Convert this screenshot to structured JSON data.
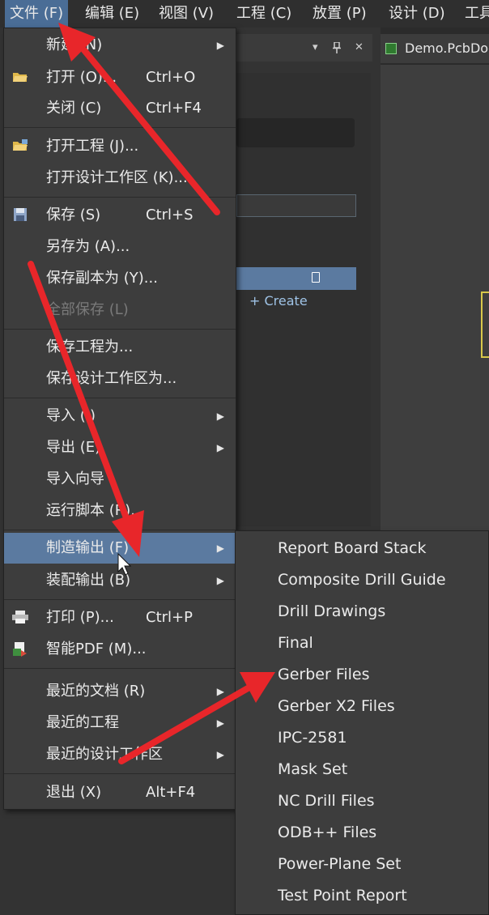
{
  "menubar": {
    "items": [
      {
        "label": "文件 (F)",
        "active": true
      },
      {
        "label": "编辑 (E)"
      },
      {
        "label": "视图 (V)"
      },
      {
        "label": "工程 (C)"
      },
      {
        "label": "放置 (P)"
      },
      {
        "label": "设计 (D)"
      },
      {
        "label": "工具"
      }
    ]
  },
  "panel": {
    "dropdown_icon": "▾",
    "pin_icon": "pin",
    "close_icon": "✕",
    "create_label": "+ Create"
  },
  "document_tab": {
    "label": "Demo.PcbDoc",
    "icon": "pcb-doc-icon"
  },
  "file_menu": {
    "items": [
      {
        "label": "新建 (N)",
        "submenu": true
      },
      {
        "label": "打开 (O)...",
        "shortcut": "Ctrl+O",
        "icon": "open-folder-icon"
      },
      {
        "label": "关闭 (C)",
        "shortcut": "Ctrl+F4"
      },
      {
        "label": "打开工程 (J)...",
        "icon": "open-project-icon"
      },
      {
        "label": "打开设计工作区 (K)..."
      },
      {
        "label": "保存 (S)",
        "shortcut": "Ctrl+S",
        "icon": "save-icon"
      },
      {
        "label": "另存为 (A)..."
      },
      {
        "label": "保存副本为 (Y)..."
      },
      {
        "label": "全部保存 (L)",
        "disabled": true
      },
      {
        "label": "保存工程为..."
      },
      {
        "label": "保存设计工作区为..."
      },
      {
        "label": "导入 (I)",
        "submenu": true
      },
      {
        "label": "导出 (E)",
        "submenu": true
      },
      {
        "label": "导入向导"
      },
      {
        "label": "运行脚本 (R)..."
      },
      {
        "label": "制造输出 (F)",
        "submenu": true,
        "highlighted": true
      },
      {
        "label": "装配输出 (B)",
        "submenu": true
      },
      {
        "label": "打印 (P)...",
        "shortcut": "Ctrl+P",
        "icon": "printer-icon"
      },
      {
        "label": "智能PDF (M)...",
        "icon": "pdf-icon"
      },
      {
        "label": "最近的文档 (R)",
        "submenu": true
      },
      {
        "label": "最近的工程",
        "submenu": true
      },
      {
        "label": "最近的设计工作区",
        "submenu": true
      },
      {
        "label": "退出 (X)",
        "shortcut": "Alt+F4"
      }
    ]
  },
  "fab_submenu": {
    "items": [
      {
        "label": "Report Board Stack"
      },
      {
        "label": "Composite Drill Guide"
      },
      {
        "label": "Drill Drawings"
      },
      {
        "label": "Final"
      },
      {
        "label": "Gerber Files"
      },
      {
        "label": "Gerber X2 Files"
      },
      {
        "label": "IPC-2581"
      },
      {
        "label": "Mask Set"
      },
      {
        "label": "NC Drill Files"
      },
      {
        "label": "ODB++ Files"
      },
      {
        "label": "Power-Plane Set"
      },
      {
        "label": "Test Point Report"
      }
    ]
  },
  "colors": {
    "menu_bg": "#3d3d3d",
    "highlight": "#5b7aa0",
    "menubar_active": "#4a6d96",
    "annotation_arrow": "#e8262a"
  }
}
